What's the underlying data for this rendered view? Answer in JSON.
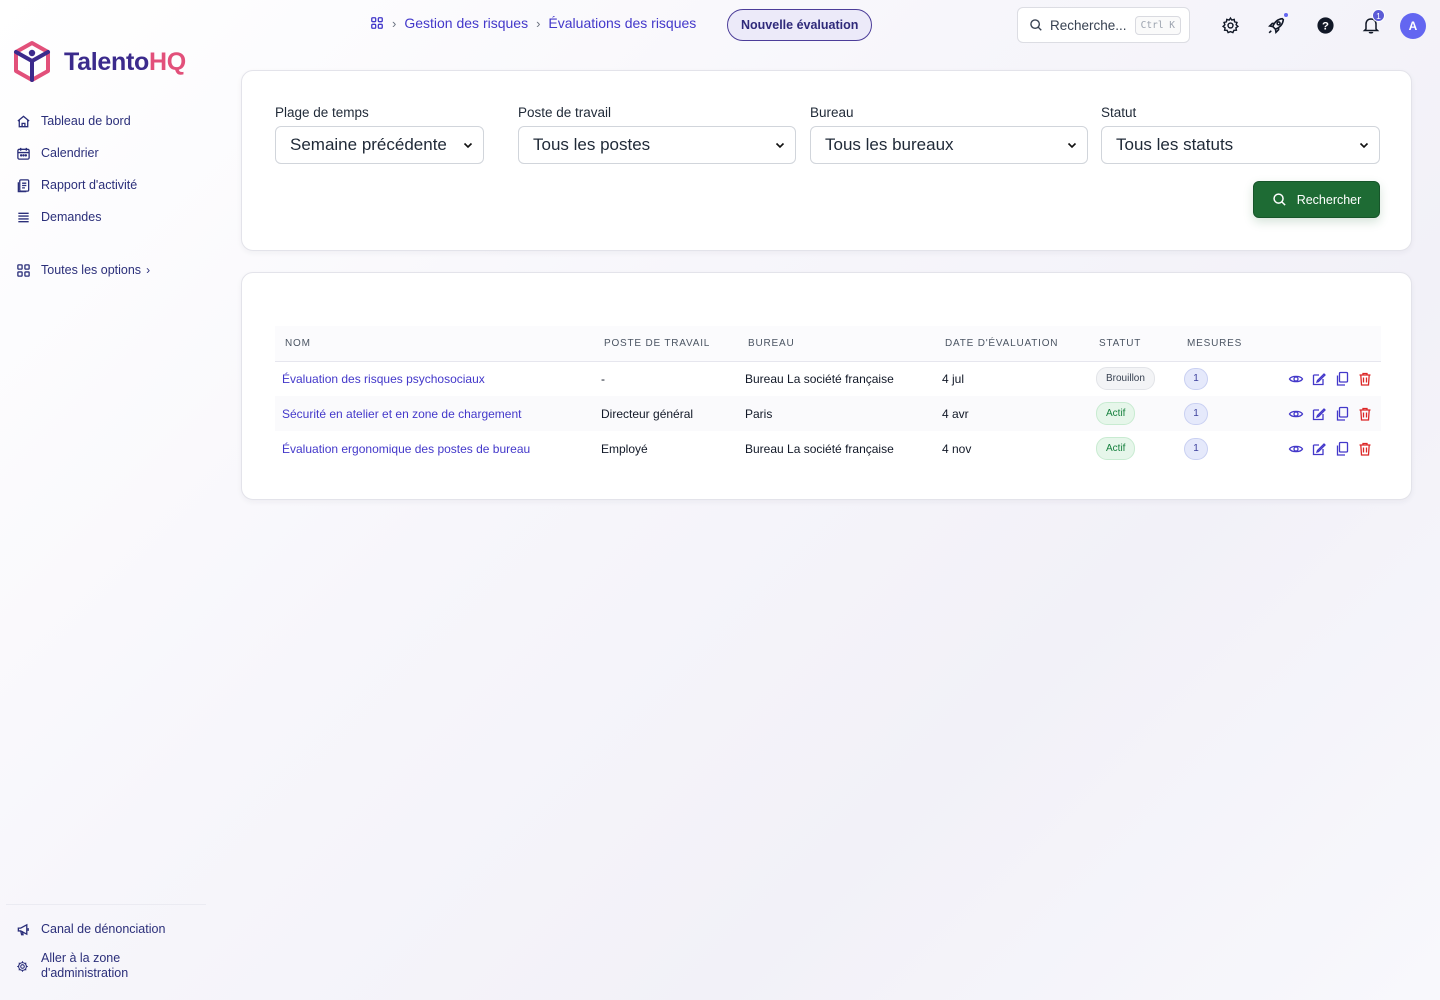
{
  "brand": {
    "name_part1": "Talento",
    "name_part2": "HQ",
    "colors": {
      "primary": "#3b2a8c",
      "accent": "#e2507a"
    }
  },
  "sidebar": {
    "items": [
      {
        "label": "Tableau de bord",
        "icon": "home-icon"
      },
      {
        "label": "Calendrier",
        "icon": "calendar-icon"
      },
      {
        "label": "Rapport d'activité",
        "icon": "report-icon"
      },
      {
        "label": "Demandes",
        "icon": "list-icon"
      }
    ],
    "all_options": {
      "label": "Toutes les options",
      "icon": "grid-icon"
    },
    "bottom": [
      {
        "label": "Canal de dénonciation",
        "icon": "megaphone-icon"
      },
      {
        "label_line1": "Aller à la zone",
        "label_line2": "d'administration",
        "icon": "gear-icon"
      }
    ]
  },
  "header": {
    "breadcrumb": [
      "Gestion des risques",
      "Évaluations des risques"
    ],
    "new_button": "Nouvelle évaluation",
    "search": {
      "placeholder": "Recherche...",
      "shortcut": "Ctrl K"
    },
    "notifications_count": "1",
    "avatar_initial": "A"
  },
  "filters": {
    "time_range": {
      "label": "Plage de temps",
      "value": "Semaine précédente"
    },
    "workstation": {
      "label": "Poste de travail",
      "value": "Tous les postes"
    },
    "office": {
      "label": "Bureau",
      "value": "Tous les bureaux"
    },
    "status": {
      "label": "Statut",
      "value": "Tous les statuts"
    },
    "search_button": "Rechercher"
  },
  "table": {
    "columns": [
      "NOM",
      "POSTE DE TRAVAIL",
      "BUREAU",
      "DATE D'ÉVALUATION",
      "STATUT",
      "MESURES"
    ],
    "rows": [
      {
        "name": "Évaluation des risques psychosociaux",
        "workstation": "-",
        "office": "Bureau La société française",
        "date": "4 jul",
        "status": "Brouillon",
        "measures": "1"
      },
      {
        "name": "Sécurité en atelier et en zone de chargement",
        "workstation": "Directeur général",
        "office": "Paris",
        "date": "4 avr",
        "status": "Actif",
        "measures": "1"
      },
      {
        "name": "Évaluation ergonomique des postes de bureau",
        "workstation": "Employé",
        "office": "Bureau La société française",
        "date": "4 nov",
        "status": "Actif",
        "measures": "1"
      }
    ]
  }
}
